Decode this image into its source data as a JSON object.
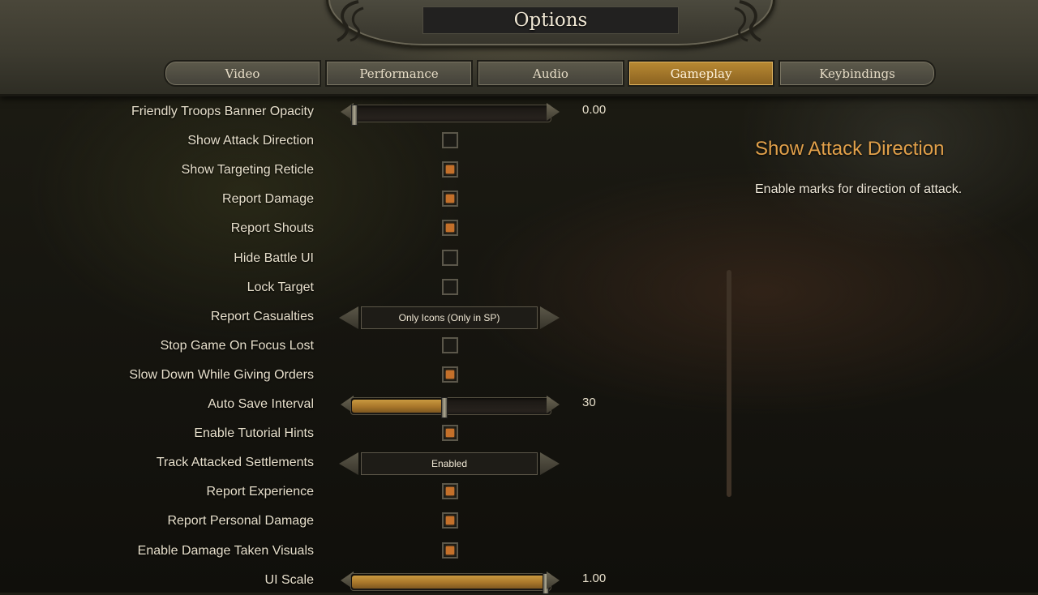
{
  "header": {
    "title": "Options"
  },
  "tabs": [
    {
      "label": "Video",
      "active": false
    },
    {
      "label": "Performance",
      "active": false
    },
    {
      "label": "Audio",
      "active": false
    },
    {
      "label": "Gameplay",
      "active": true
    },
    {
      "label": "Keybindings",
      "active": false
    }
  ],
  "options": [
    {
      "label": "Friendly Troops Banner Opacity",
      "type": "slider",
      "value": "0.00",
      "fraction": 0.0
    },
    {
      "label": "Show Attack Direction",
      "type": "checkbox",
      "checked": false
    },
    {
      "label": "Show Targeting Reticle",
      "type": "checkbox",
      "checked": true
    },
    {
      "label": "Report Damage",
      "type": "checkbox",
      "checked": true
    },
    {
      "label": "Report Shouts",
      "type": "checkbox",
      "checked": true
    },
    {
      "label": "Hide Battle UI",
      "type": "checkbox",
      "checked": false
    },
    {
      "label": "Lock Target",
      "type": "checkbox",
      "checked": false
    },
    {
      "label": "Report Casualties",
      "type": "dropdown",
      "value": "Only Icons (Only in SP)"
    },
    {
      "label": "Stop Game On Focus Lost",
      "type": "checkbox",
      "checked": false
    },
    {
      "label": "Slow Down While Giving Orders",
      "type": "checkbox",
      "checked": true
    },
    {
      "label": "Auto Save Interval",
      "type": "slider",
      "value": "30",
      "fraction": 0.47
    },
    {
      "label": "Enable Tutorial Hints",
      "type": "checkbox",
      "checked": true
    },
    {
      "label": "Track Attacked Settlements",
      "type": "dropdown",
      "value": "Enabled"
    },
    {
      "label": "Report Experience",
      "type": "checkbox",
      "checked": true
    },
    {
      "label": "Report Personal Damage",
      "type": "checkbox",
      "checked": true
    },
    {
      "label": "Enable Damage Taken Visuals",
      "type": "checkbox",
      "checked": true
    },
    {
      "label": "UI Scale",
      "type": "slider",
      "value": "1.00",
      "fraction": 1.0
    }
  ],
  "description": {
    "title": "Show Attack Direction",
    "text": "Enable marks for direction of attack."
  },
  "colors": {
    "accent": "#c4702a",
    "description_title": "#e1a04a",
    "active_tab": "#b98a33"
  }
}
